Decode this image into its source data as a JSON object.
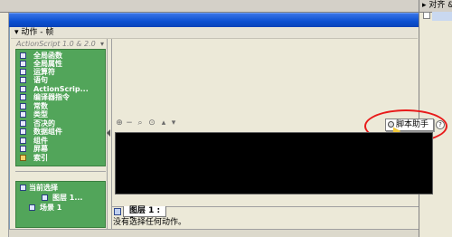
{
  "background": {
    "right_panel_header": "▸ 对齐 &"
  },
  "panel": {
    "title": "▾ 动作 - 帧",
    "script_mode": "ActionScript 1.0 & 2.0"
  },
  "actions": {
    "items": [
      {
        "label": "全局函数",
        "icon": "book-icon"
      },
      {
        "label": "全局属性",
        "icon": "book-icon"
      },
      {
        "label": "运算符",
        "icon": "book-icon"
      },
      {
        "label": "语句",
        "icon": "book-icon"
      },
      {
        "label": "ActionScrip...",
        "icon": "book-icon"
      },
      {
        "label": "编译器指令",
        "icon": "book-icon"
      },
      {
        "label": "常数",
        "icon": "book-icon"
      },
      {
        "label": "类型",
        "icon": "book-icon"
      },
      {
        "label": "否决的",
        "icon": "book-icon"
      },
      {
        "label": "数据组件",
        "icon": "book-icon"
      },
      {
        "label": "组件",
        "icon": "book-icon"
      },
      {
        "label": "屏幕",
        "icon": "book-icon"
      },
      {
        "label": "索引",
        "icon": "index-icon"
      }
    ]
  },
  "selection_tree": {
    "current": "当前选择",
    "layer": "图层 1...",
    "scene": "场景 1"
  },
  "script_helper": {
    "label": "脚本助手"
  },
  "bottom": {
    "tab_label": "图层 1 : 1",
    "status": "没有选择任何动作。"
  },
  "colors": {
    "accent_green": "#52a55a",
    "title_blue": "#0a4fd0",
    "highlight_red": "#e81a1a",
    "editor_bg": "#000000"
  }
}
